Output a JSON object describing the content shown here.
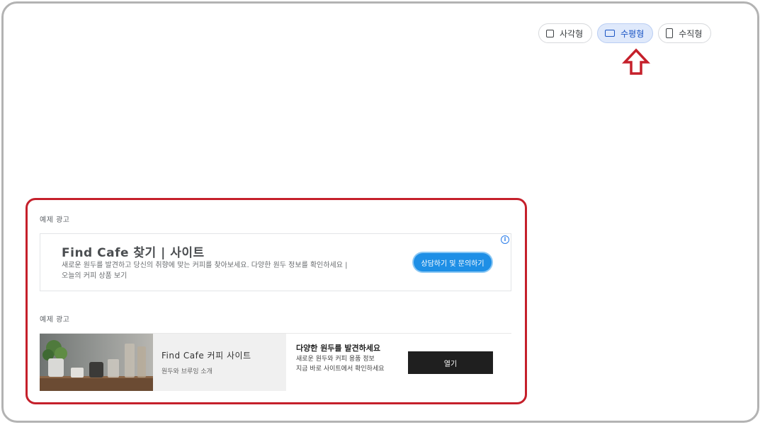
{
  "format_toggle": {
    "options": [
      {
        "label": "사각형",
        "icon": "square-icon",
        "selected": false
      },
      {
        "label": "수평형",
        "icon": "horizontal-rect-icon",
        "selected": true
      },
      {
        "label": "수직형",
        "icon": "vertical-rect-icon",
        "selected": false
      }
    ]
  },
  "annotations": {
    "arrow_color": "#c5202b",
    "highlight_color": "#c5202b"
  },
  "preview": {
    "ad1": {
      "label": "예제 광고",
      "title": "Find Cafe 찾기 | 사이트",
      "description": "새로운 원두를 발견하고 당신의 취향에 맞는 커피를 찾아보세요. 다양한 원두 정보를 확인하세요 |",
      "description2": "오늘의 커피 상품 보기",
      "cta": "상담하기 및 문의하기",
      "info_icon": "i"
    },
    "ad2": {
      "label": "예제 광고",
      "headline": "Find Cafe 커피 사이트",
      "subtitle": "원두와 브루잉 소개",
      "right_heading": "다양한 원두를 발견하세요",
      "right_desc_1": "새로운 원두와 커피 용품 정보",
      "right_desc_2": "지금 바로 사이트에서 확인하세요",
      "button": "열기"
    }
  }
}
